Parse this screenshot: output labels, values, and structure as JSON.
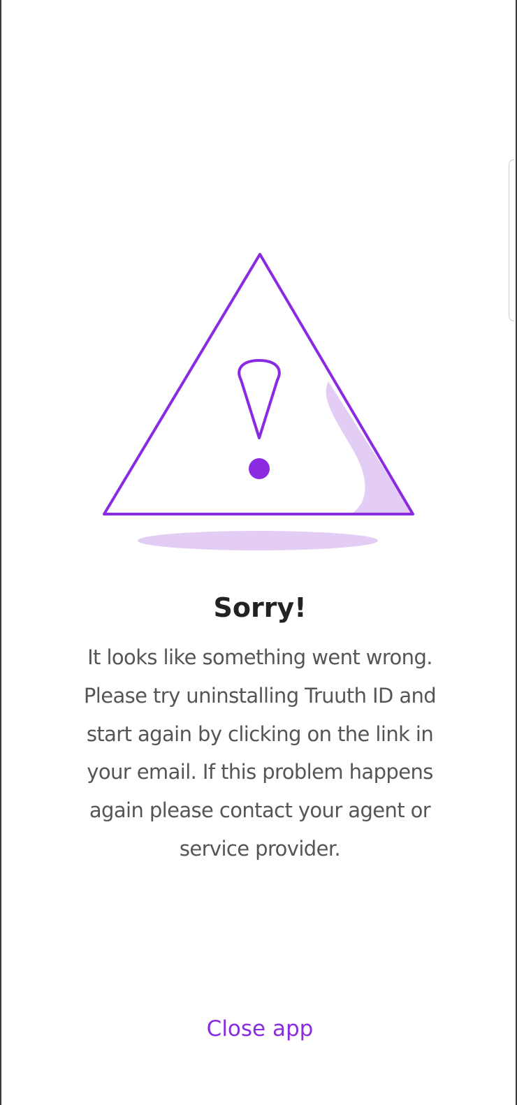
{
  "dialog": {
    "title": "Sorry!",
    "message": "It looks like something went wrong. Please try uninstalling Truuth ID and start again by clicking on the link in your email. If this problem happens again please contact your agent or service provider.",
    "close_label": "Close app"
  },
  "icons": {
    "illustration": "warning-triangle-icon"
  },
  "colors": {
    "accent": "#8A2BE2",
    "accent_light": "#E4CDF5",
    "title_text": "#222222",
    "body_text": "#555555",
    "background": "#FFFFFF"
  }
}
